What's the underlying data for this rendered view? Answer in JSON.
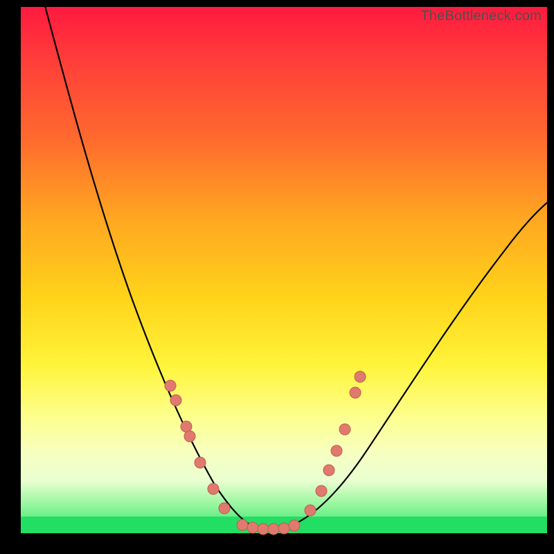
{
  "watermark": {
    "text": "TheBottleneck.com"
  },
  "colors": {
    "frame_bg": "#000000",
    "curve": "#000000",
    "dot_fill": "#e07a6e",
    "dot_stroke": "#c45a4e",
    "gradient_stops": [
      "#ff1a3f",
      "#ff3d3a",
      "#ff6a2e",
      "#ffa621",
      "#ffd31a",
      "#fff43a",
      "#fdff8e",
      "#f6ffc2",
      "#e9ffd0",
      "#8ff59a",
      "#28e36a"
    ]
  },
  "chart_data": {
    "type": "line",
    "title": "",
    "xlabel": "",
    "ylabel": "",
    "xlim": [
      0,
      100
    ],
    "ylim": [
      0,
      100
    ],
    "grid": false,
    "legend": false,
    "notes": "Two black curves forming an asymmetric V over a vertical rainbow gradient (red at top → green at bottom). Salmon dots cluster along both curve arms near the bottom of the V. Axes have no tick labels; values below are coarse visual estimates on a 0–100 × 0–100 canvas.",
    "series": [
      {
        "name": "left-arm",
        "x": [
          5,
          10,
          15,
          20,
          25,
          30,
          34,
          38,
          41,
          43,
          45
        ],
        "y": [
          100,
          80,
          62,
          48,
          36,
          25,
          16,
          9,
          4,
          1,
          0
        ]
      },
      {
        "name": "right-arm",
        "x": [
          48,
          52,
          58,
          65,
          72,
          80,
          88,
          96,
          100
        ],
        "y": [
          0,
          1,
          5,
          12,
          22,
          35,
          48,
          58,
          63
        ]
      },
      {
        "name": "flat-bottom",
        "x": [
          43,
          45,
          47,
          49,
          51
        ],
        "y": [
          0,
          0,
          0,
          0,
          0
        ]
      }
    ],
    "scatter": [
      {
        "name": "dots-left-arm",
        "points": [
          {
            "x": 28.5,
            "y": 28
          },
          {
            "x": 29.5,
            "y": 25
          },
          {
            "x": 31.5,
            "y": 20
          },
          {
            "x": 32.0,
            "y": 18
          },
          {
            "x": 34.0,
            "y": 13
          },
          {
            "x": 36.5,
            "y": 8
          },
          {
            "x": 38.5,
            "y": 4
          }
        ]
      },
      {
        "name": "dots-flat",
        "points": [
          {
            "x": 42,
            "y": 1
          },
          {
            "x": 44,
            "y": 0.5
          },
          {
            "x": 46,
            "y": 0.5
          },
          {
            "x": 48,
            "y": 0.5
          },
          {
            "x": 50,
            "y": 0.5
          },
          {
            "x": 52,
            "y": 1
          }
        ]
      },
      {
        "name": "dots-right-arm",
        "points": [
          {
            "x": 55,
            "y": 4
          },
          {
            "x": 57,
            "y": 8
          },
          {
            "x": 58.5,
            "y": 12
          },
          {
            "x": 60,
            "y": 16
          },
          {
            "x": 61.5,
            "y": 20
          },
          {
            "x": 63.5,
            "y": 27
          },
          {
            "x": 64.5,
            "y": 30
          }
        ]
      }
    ]
  }
}
